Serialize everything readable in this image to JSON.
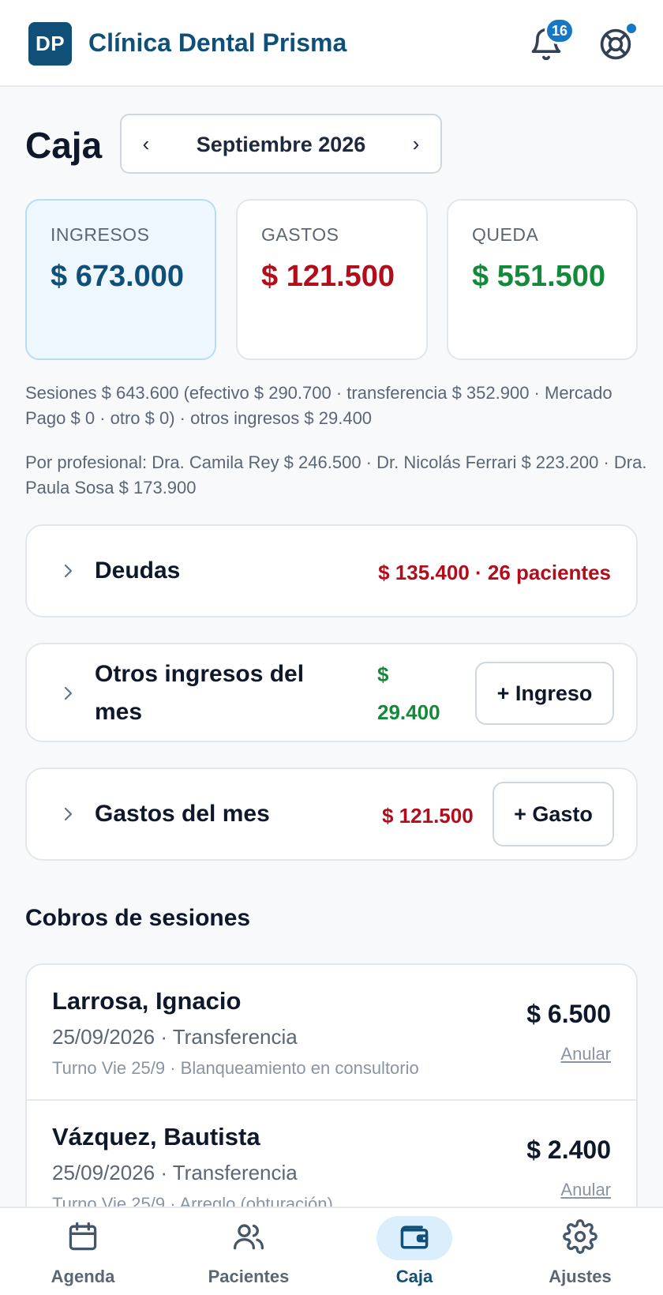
{
  "header": {
    "logo_text": "DP",
    "app_title": "Clínica Dental Prisma",
    "notification_count": "16",
    "icons": [
      "bell-icon",
      "lifebuoy-icon"
    ],
    "accent_color": "#1677c4",
    "brand_color": "#0f4f78"
  },
  "page": {
    "title": "Caja",
    "month_picker": {
      "prev": "‹",
      "label": "Septiembre 2026",
      "next": "›"
    }
  },
  "summary": {
    "income": {
      "label": "INGRESOS",
      "value": "$ 673.000"
    },
    "expense": {
      "label": "GASTOS",
      "value": "$ 121.500"
    },
    "remaining": {
      "label": "QUEDA",
      "value": "$ 551.500"
    }
  },
  "details": {
    "sessions": "Sesiones $ 643.600 (efectivo $ 290.700 · transferencia $ 352.900 · Mercado Pago $ 0 · otro $ 0) · otros ingresos $ 29.400",
    "by_professional": "Por profesional: Dra. Camila Rey $ 246.500 · Dr. Nicolás Ferrari $ 223.200 · Dra. Paula Sosa $ 173.900"
  },
  "sections": {
    "debts": {
      "title": "Deudas",
      "value": "$ 135.400 · 26 pacientes"
    },
    "other_income": {
      "title": "Otros ingresos del mes",
      "value": "$ 29.400",
      "button": "+ Ingreso"
    },
    "expenses": {
      "title": "Gastos del mes",
      "value": "$ 121.500",
      "button": "+ Gasto"
    }
  },
  "payments": {
    "title": "Cobros de sesiones",
    "rows": [
      {
        "name": "Larrosa, Ignacio",
        "meta": "25/09/2026 · Transferencia",
        "sub": "Turno Vie 25/9 · Blanqueamiento en consultorio",
        "amount": "$ 6.500",
        "action": "Anular"
      },
      {
        "name": "Vázquez, Bautista",
        "meta": "25/09/2026 · Transferencia",
        "sub": "Turno Vie 25/9 · Arreglo (obturación)",
        "amount": "$ 2.400",
        "action": "Anular"
      }
    ]
  },
  "nav": {
    "items": [
      {
        "label": "Agenda",
        "icon": "calendar-icon"
      },
      {
        "label": "Pacientes",
        "icon": "users-icon"
      },
      {
        "label": "Caja",
        "icon": "wallet-icon",
        "active": true
      },
      {
        "label": "Ajustes",
        "icon": "gear-icon"
      }
    ]
  }
}
